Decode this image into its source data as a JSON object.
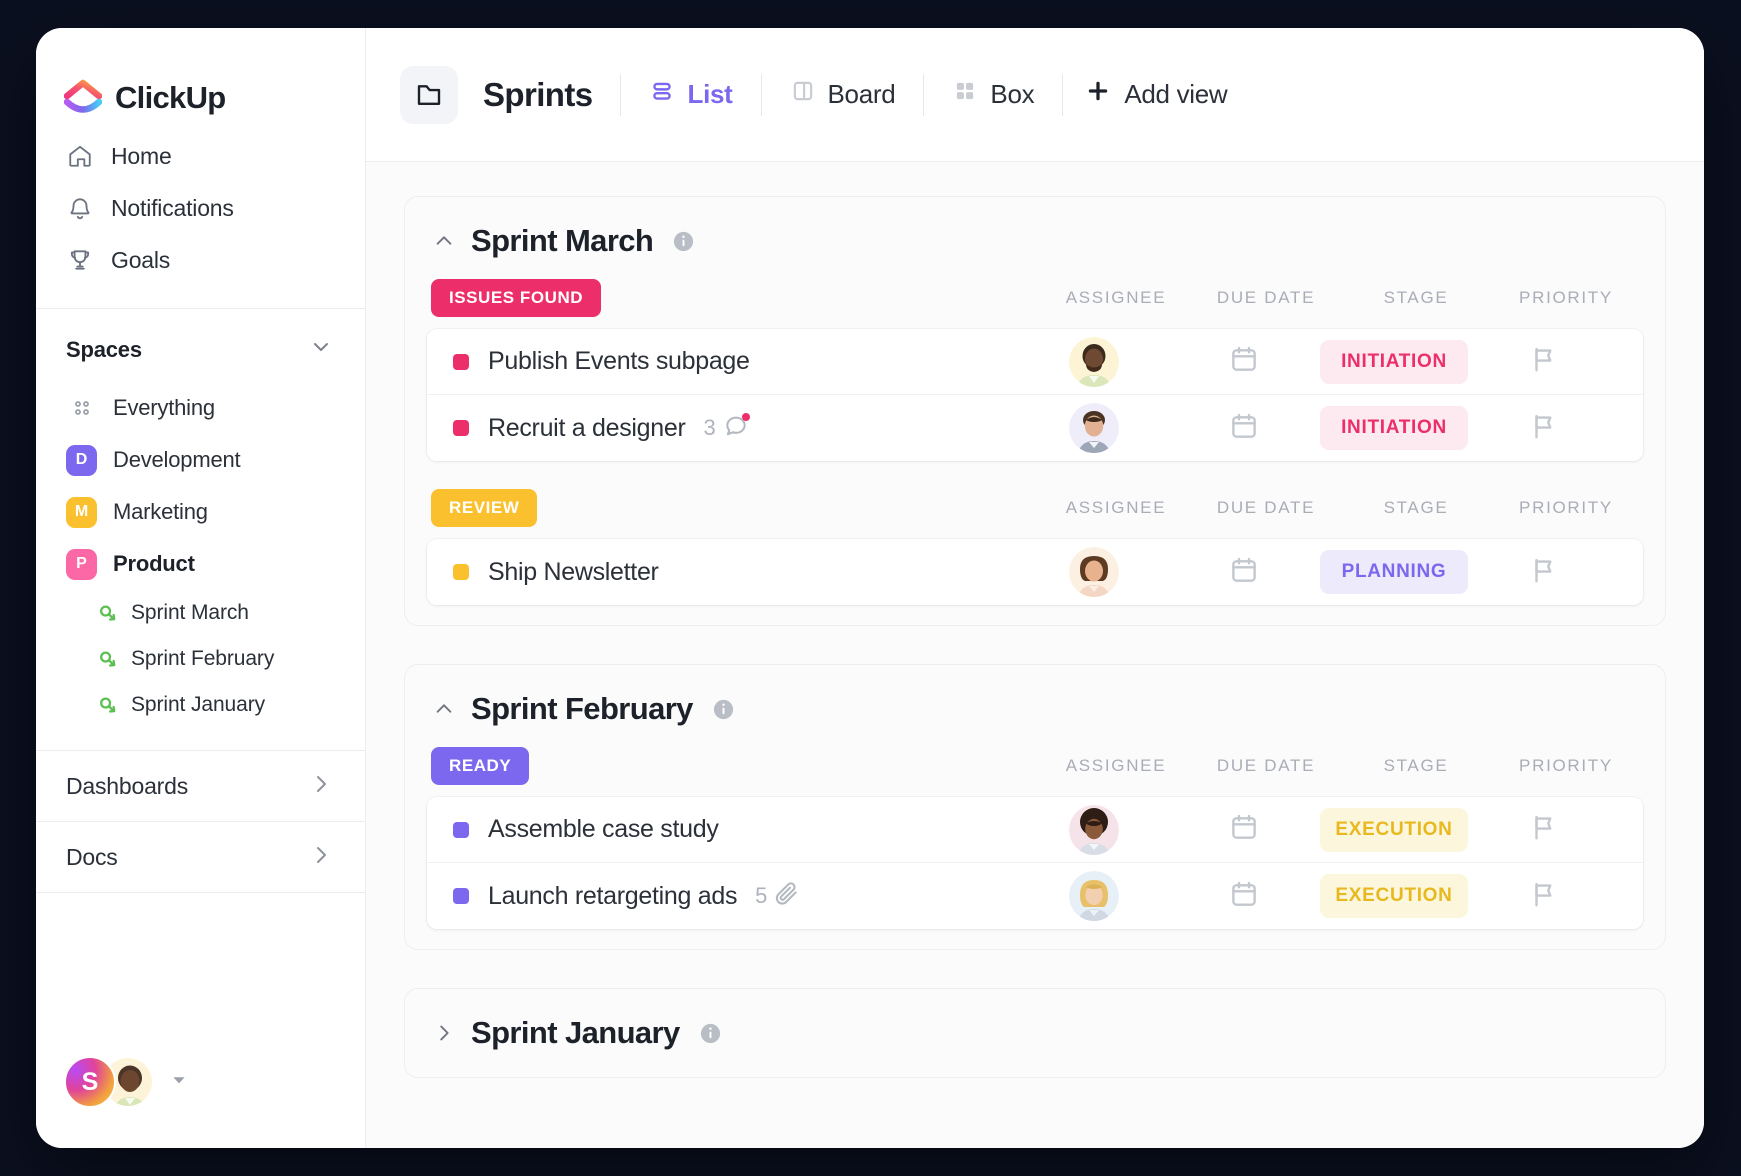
{
  "brand": {
    "name": "ClickUp",
    "logo_icon": "clickup-logo-icon"
  },
  "sidebar": {
    "nav": [
      {
        "label": "Home",
        "icon": "home-icon"
      },
      {
        "label": "Notifications",
        "icon": "bell-icon"
      },
      {
        "label": "Goals",
        "icon": "trophy-icon"
      }
    ],
    "spaces_title": "Spaces",
    "spaces_caret_icon": "chevron-down-icon",
    "everything": {
      "label": "Everything",
      "icon": "grid-dots-icon"
    },
    "spaces": [
      {
        "label": "Development",
        "initial": "D",
        "color": "#7b68ee",
        "active": false
      },
      {
        "label": "Marketing",
        "initial": "M",
        "color": "#fbc02d",
        "active": false
      },
      {
        "label": "Product",
        "initial": "P",
        "color": "#fc67a5",
        "active": true
      }
    ],
    "sprints": [
      {
        "label": "Sprint  March",
        "icon": "sprint-icon"
      },
      {
        "label": "Sprint  February",
        "icon": "sprint-icon"
      },
      {
        "label": "Sprint January",
        "icon": "sprint-icon"
      }
    ],
    "sections": [
      {
        "label": "Dashboards",
        "icon": "chevron-right-icon"
      },
      {
        "label": "Docs",
        "icon": "chevron-right-icon"
      }
    ],
    "footer": {
      "workspace_initial": "S",
      "user_avatar": "user-avatar",
      "caret_icon": "caret-down-icon"
    }
  },
  "topbar": {
    "folder_icon": "folder-icon",
    "title": "Sprints",
    "views": [
      {
        "label": "List",
        "icon": "list-view-icon",
        "active": true
      },
      {
        "label": "Board",
        "icon": "board-view-icon",
        "active": false
      },
      {
        "label": "Box",
        "icon": "box-view-icon",
        "active": false
      }
    ],
    "add_view": {
      "label": "Add view",
      "icon": "plus-icon"
    }
  },
  "columns": {
    "assignee": "ASSIGNEE",
    "due_date": "DUE DATE",
    "stage": "STAGE",
    "priority": "PRIORITY"
  },
  "colors": {
    "accent_purple": "#7b68ee",
    "issues_found": "#ec2f6a",
    "review": "#fbc02d",
    "ready": "#7b68ee",
    "initiation_bg": "#fdeaf0",
    "initiation_fg": "#ec2f6a",
    "planning_bg": "#eceafb",
    "planning_fg": "#7b68ee",
    "execution_bg": "#fcf6dc",
    "execution_fg": "#e8b91f"
  },
  "sprints": [
    {
      "title": "Sprint March",
      "collapsed": false,
      "chevron_icon": "chevron-up-icon",
      "info_icon": "info-icon",
      "groups": [
        {
          "chip_label": "ISSUES FOUND",
          "chip_color": "#ec2f6a",
          "tasks": [
            {
              "name": "Publish Events subpage",
              "dot_color": "#ec2f6a",
              "meta_count": "",
              "meta_icon": "",
              "assignee": "avatar-man-beard",
              "due_date_icon": "calendar-icon",
              "stage": "INITIATION",
              "stage_bg": "#fdeaf0",
              "stage_fg": "#ec2f6a",
              "priority_icon": "flag-icon"
            },
            {
              "name": "Recruit a designer",
              "dot_color": "#ec2f6a",
              "meta_count": "3",
              "meta_icon": "comment-icon",
              "assignee": "avatar-man-smiling",
              "due_date_icon": "calendar-icon",
              "stage": "INITIATION",
              "stage_bg": "#fdeaf0",
              "stage_fg": "#ec2f6a",
              "priority_icon": "flag-icon"
            }
          ]
        },
        {
          "chip_label": "REVIEW",
          "chip_color": "#fbc02d",
          "tasks": [
            {
              "name": "Ship Newsletter",
              "dot_color": "#fbc02d",
              "meta_count": "",
              "meta_icon": "",
              "assignee": "avatar-woman-brown-hair",
              "due_date_icon": "calendar-icon",
              "stage": "PLANNING",
              "stage_bg": "#eceafb",
              "stage_fg": "#7b68ee",
              "priority_icon": "flag-icon"
            }
          ]
        }
      ]
    },
    {
      "title": "Sprint February",
      "collapsed": false,
      "chevron_icon": "chevron-up-icon",
      "info_icon": "info-icon",
      "groups": [
        {
          "chip_label": "READY",
          "chip_color": "#7b68ee",
          "tasks": [
            {
              "name": "Assemble case study",
              "dot_color": "#7b68ee",
              "meta_count": "",
              "meta_icon": "",
              "assignee": "avatar-man-afro",
              "due_date_icon": "calendar-icon",
              "stage": "EXECUTION",
              "stage_bg": "#fcf6dc",
              "stage_fg": "#e8b91f",
              "priority_icon": "flag-icon"
            },
            {
              "name": "Launch retargeting ads",
              "dot_color": "#7b68ee",
              "meta_count": "5",
              "meta_icon": "paperclip-icon",
              "assignee": "avatar-woman-blonde",
              "due_date_icon": "calendar-icon",
              "stage": "EXECUTION",
              "stage_bg": "#fcf6dc",
              "stage_fg": "#e8b91f",
              "priority_icon": "flag-icon"
            }
          ]
        }
      ]
    },
    {
      "title": "Sprint January",
      "collapsed": true,
      "chevron_icon": "chevron-right-icon",
      "info_icon": "info-icon",
      "groups": []
    }
  ]
}
